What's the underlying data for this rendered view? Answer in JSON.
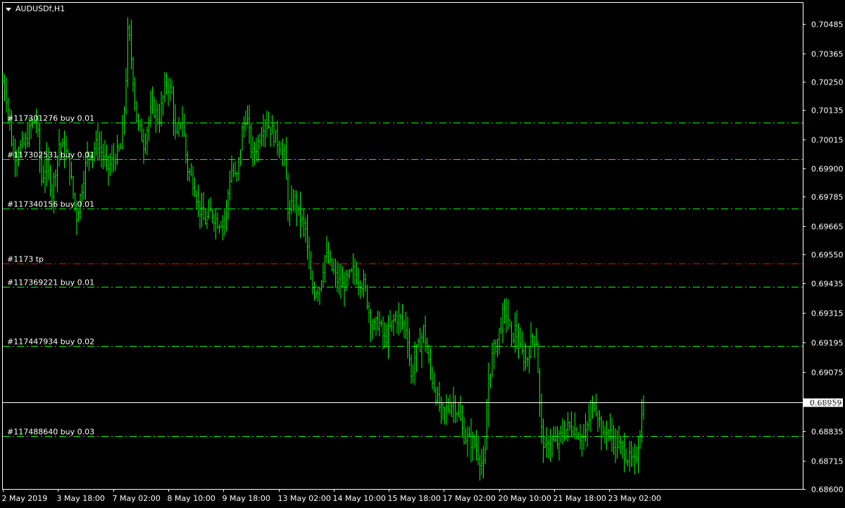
{
  "window": {
    "symbol_title": "AUDUSDf,H1"
  },
  "colors": {
    "background": "#000000",
    "foreground": "#ffffff",
    "bars": "#00ff00",
    "order_line": "#00ff00",
    "tp_line": "#ff0000",
    "bid_line": "#ffffff"
  },
  "chart_data": {
    "type": "bar",
    "ylim": [
      0.686,
      0.7057
    ],
    "y_ticks": [
      "0.70485",
      "0.70365",
      "0.70250",
      "0.70135",
      "0.70015",
      "0.69900",
      "0.69785",
      "0.69665",
      "0.69550",
      "0.69435",
      "0.69315",
      "0.69195",
      "0.69075",
      "0.68955",
      "0.68835",
      "0.68715",
      "0.68600"
    ],
    "x_ticks": [
      "2 May 2019",
      "3 May 18:00",
      "7 May 02:00",
      "8 May 10:00",
      "9 May 18:00",
      "13 May 02:00",
      "14 May 10:00",
      "15 May 18:00",
      "17 May 02:00",
      "20 May 10:00",
      "21 May 18:00",
      "23 May 02:00"
    ],
    "bar_count": 360,
    "close_path": [
      [
        0,
        0.7025
      ],
      [
        6,
        0.7018
      ],
      [
        15,
        0.6995
      ],
      [
        23,
        0.6998
      ],
      [
        32,
        0.7
      ],
      [
        40,
        0.7007
      ],
      [
        48,
        0.701
      ],
      [
        55,
        0.6985
      ],
      [
        62,
        0.6992
      ],
      [
        70,
        0.698
      ],
      [
        80,
        0.7
      ],
      [
        92,
        0.6995
      ],
      [
        105,
        0.697
      ],
      [
        120,
        0.6995
      ],
      [
        135,
        0.7
      ],
      [
        150,
        0.699
      ],
      [
        160,
        0.6995
      ],
      [
        168,
        0.6998
      ],
      [
        174,
        0.702
      ],
      [
        178,
        0.7048
      ],
      [
        184,
        0.703
      ],
      [
        190,
        0.701
      ],
      [
        200,
        0.7
      ],
      [
        212,
        0.7015
      ],
      [
        222,
        0.701
      ],
      [
        232,
        0.7025
      ],
      [
        240,
        0.702
      ],
      [
        246,
        0.7
      ],
      [
        254,
        0.7012
      ],
      [
        262,
        0.699
      ],
      [
        270,
        0.6985
      ],
      [
        278,
        0.6975
      ],
      [
        286,
        0.6968
      ],
      [
        296,
        0.6972
      ],
      [
        306,
        0.6968
      ],
      [
        316,
        0.697
      ],
      [
        324,
        0.699
      ],
      [
        332,
        0.6985
      ],
      [
        340,
        0.7005
      ],
      [
        346,
        0.7012
      ],
      [
        354,
        0.6995
      ],
      [
        362,
        0.7
      ],
      [
        372,
        0.701
      ],
      [
        382,
        0.7005
      ],
      [
        392,
        0.7
      ],
      [
        400,
        0.6995
      ],
      [
        406,
        0.697
      ],
      [
        414,
        0.6978
      ],
      [
        422,
        0.697
      ],
      [
        430,
        0.6965
      ],
      [
        436,
        0.6945
      ],
      [
        442,
        0.694
      ],
      [
        450,
        0.6942
      ],
      [
        458,
        0.6955
      ],
      [
        466,
        0.695
      ],
      [
        474,
        0.6945
      ],
      [
        482,
        0.6942
      ],
      [
        490,
        0.6945
      ],
      [
        498,
        0.6948
      ],
      [
        506,
        0.6945
      ],
      [
        514,
        0.6942
      ],
      [
        520,
        0.6932
      ],
      [
        526,
        0.6925
      ],
      [
        534,
        0.6928
      ],
      [
        542,
        0.692
      ],
      [
        550,
        0.6925
      ],
      [
        558,
        0.693
      ],
      [
        566,
        0.6928
      ],
      [
        574,
        0.6925
      ],
      [
        580,
        0.6905
      ],
      [
        586,
        0.6915
      ],
      [
        592,
        0.6918
      ],
      [
        598,
        0.6925
      ],
      [
        604,
        0.6912
      ],
      [
        612,
        0.6902
      ],
      [
        618,
        0.6895
      ],
      [
        624,
        0.689
      ],
      [
        632,
        0.6893
      ],
      [
        640,
        0.6895
      ],
      [
        648,
        0.689
      ],
      [
        654,
        0.6882
      ],
      [
        662,
        0.688
      ],
      [
        670,
        0.6878
      ],
      [
        678,
        0.6872
      ],
      [
        684,
        0.6868
      ],
      [
        690,
        0.6905
      ],
      [
        696,
        0.6915
      ],
      [
        702,
        0.692
      ],
      [
        710,
        0.693
      ],
      [
        716,
        0.6932
      ],
      [
        722,
        0.692
      ],
      [
        728,
        0.6925
      ],
      [
        736,
        0.6915
      ],
      [
        744,
        0.6912
      ],
      [
        752,
        0.6922
      ],
      [
        758,
        0.692
      ],
      [
        764,
        0.6885
      ],
      [
        770,
        0.6875
      ],
      [
        778,
        0.688
      ],
      [
        786,
        0.6878
      ],
      [
        794,
        0.6882
      ],
      [
        802,
        0.6885
      ],
      [
        810,
        0.6885
      ],
      [
        818,
        0.6882
      ],
      [
        826,
        0.688
      ],
      [
        834,
        0.689
      ],
      [
        840,
        0.6895
      ],
      [
        846,
        0.689
      ],
      [
        852,
        0.688
      ],
      [
        858,
        0.6885
      ],
      [
        866,
        0.688
      ],
      [
        874,
        0.6878
      ],
      [
        882,
        0.6875
      ],
      [
        890,
        0.6872
      ],
      [
        898,
        0.687
      ],
      [
        904,
        0.6882
      ],
      [
        910,
        0.6895
      ]
    ]
  },
  "levels": [
    {
      "label": "#117301276 buy 0.01",
      "price": 0.70085,
      "kind": "order"
    },
    {
      "label": "#117302531 buy 0.01",
      "price": 0.69935,
      "kind": "order"
    },
    {
      "label": "#117340156 buy 0.01",
      "price": 0.69735,
      "kind": "order"
    },
    {
      "label": "#1173 tp",
      "price": 0.69515,
      "kind": "tp"
    },
    {
      "label": "#117369221 buy 0.01",
      "price": 0.6942,
      "kind": "order"
    },
    {
      "label": "#117447934 buy 0.02",
      "price": 0.6918,
      "kind": "order"
    },
    {
      "label": "#117488640 buy 0.03",
      "price": 0.68815,
      "kind": "order"
    }
  ],
  "bid": {
    "price": 0.6895,
    "label": "0.68959"
  }
}
